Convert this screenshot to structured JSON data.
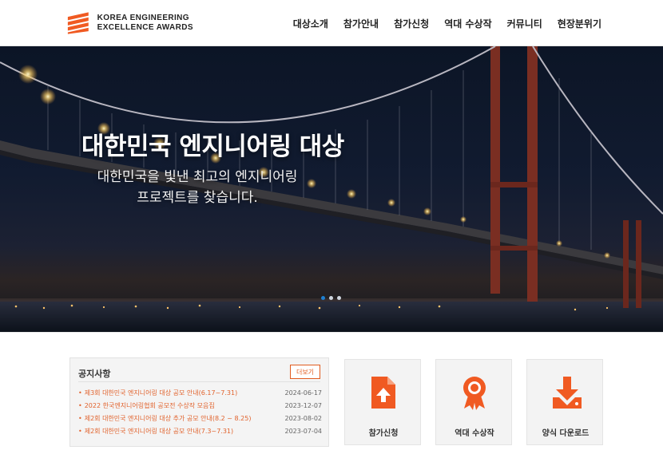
{
  "brand": {
    "line1": "KOREA ENGINEERING",
    "line2": "EXCELLENCE AWARDS",
    "accent": "#f05a22"
  },
  "nav": {
    "items": [
      "대상소개",
      "참가안내",
      "참가신청",
      "역대 수상작",
      "커뮤니티",
      "현장분위기"
    ]
  },
  "hero": {
    "title": "대한민국 엔지니어링 대상",
    "subtitle_line1": "대한민국을 빛낸 최고의 엔지니어링",
    "subtitle_line2": "프로젝트를 찾습니다.",
    "slides_total": 3,
    "active_slide": 1
  },
  "notice": {
    "title": "공지사항",
    "more_label": "더보기",
    "items": [
      {
        "text": "제3회 대한민국 엔지니어링 대상 공모 안내(6.17~7.31)",
        "date": "2024-06-17"
      },
      {
        "text": "2022 한국엔지니어링협회 공모전 수상작 모음집",
        "date": "2023-12-07"
      },
      {
        "text": "제2회 대한민국 엔지니어링 대상 추가 공모 안내(8.2 ~ 8.25)",
        "date": "2023-08-02"
      },
      {
        "text": "제2회 대한민국 엔지니어링 대상 공모 안내(7.3~7.31)",
        "date": "2023-07-04"
      }
    ]
  },
  "quick_links": [
    {
      "label": "참가신청",
      "icon": "file-upload-icon"
    },
    {
      "label": "역대 수상작",
      "icon": "award-badge-icon"
    },
    {
      "label": "양식 다운로드",
      "icon": "download-icon"
    }
  ]
}
